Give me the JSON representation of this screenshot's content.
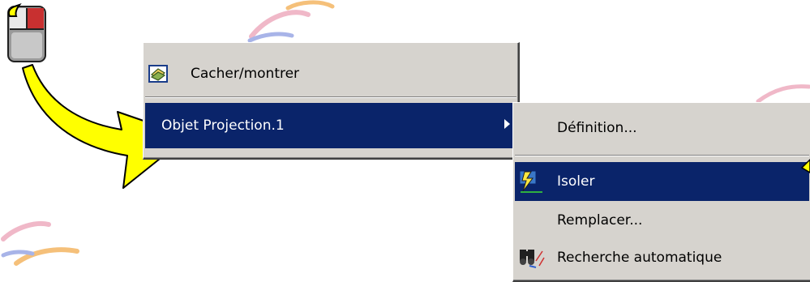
{
  "context_menu": {
    "items": [
      {
        "label": "Cacher/montrer",
        "icon": "hide-show-icon"
      },
      {
        "label": "Objet Projection.1",
        "selected": true,
        "submenu_arrow": "submenu-arrow-icon"
      }
    ]
  },
  "submenu": {
    "items": [
      {
        "label": "Définition..."
      },
      {
        "label": "Isoler",
        "icon": "isolate-icon",
        "selected": true
      },
      {
        "label": "Remplacer..."
      },
      {
        "label": "Recherche automatique",
        "icon": "binoculars-search-icon"
      }
    ]
  },
  "colors": {
    "menu_bg": "#d6d3ce",
    "selection_bg": "#0a246a",
    "callout_arrow": "#ffff00"
  }
}
